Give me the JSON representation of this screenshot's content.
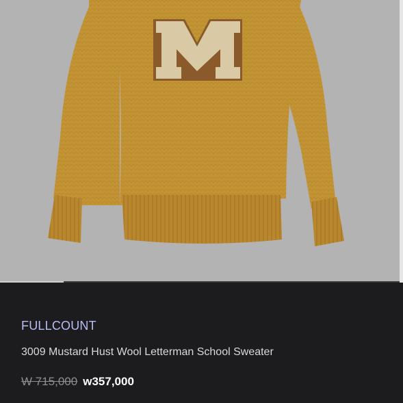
{
  "product": {
    "brand": "FULLCOUNT",
    "name": "3009 Mustard Hust Wool Letterman School Sweater",
    "original_price": "W 715,000",
    "sale_price": "w357,000",
    "image_label": "M",
    "image_alt": "mustard-letterman-sweater"
  },
  "gallery": {
    "progress": 0.16
  },
  "colors": {
    "sweater": "#c39434",
    "ribbing": "#b7862c",
    "letter_fill": "#d9c9a4",
    "letter_edge": "#8a5a2a",
    "background": "#b3b3b3",
    "brand": "#b8bdf5"
  }
}
